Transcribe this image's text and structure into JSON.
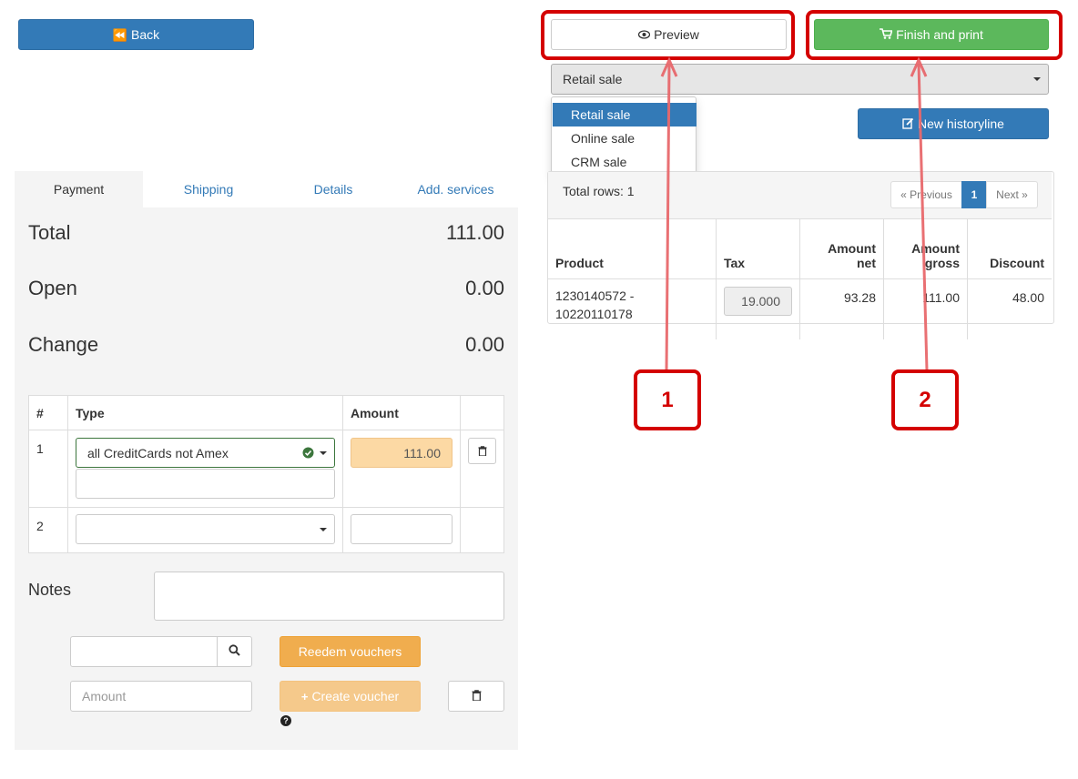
{
  "header": {
    "back_label": "Back",
    "preview_label": "Preview",
    "finish_label": "Finish and print"
  },
  "sale_type": {
    "selected": "Retail sale",
    "options": [
      "Retail sale",
      "Online sale",
      "CRM sale"
    ]
  },
  "new_historyline_label": "New historyline",
  "tabs": [
    "Payment",
    "Shipping",
    "Details",
    "Add. services"
  ],
  "summary": {
    "total_label": "Total",
    "total_value": "111.00",
    "open_label": "Open",
    "open_value": "0.00",
    "change_label": "Change",
    "change_value": "0.00"
  },
  "payment_table": {
    "headers": [
      "#",
      "Type",
      "Amount",
      ""
    ],
    "rows": [
      {
        "num": "1",
        "type": "all CreditCards not Amex",
        "amount": "111.00"
      },
      {
        "num": "2",
        "type": "",
        "amount": ""
      }
    ]
  },
  "notes_label": "Notes",
  "voucher": {
    "redeem_label": "Reedem vouchers",
    "amount_placeholder": "Amount",
    "create_label": "Create voucher"
  },
  "grid": {
    "total_rows_label": "Total rows: 1",
    "pager": {
      "prev": "« Previous",
      "page": "1",
      "next": "Next »"
    },
    "headers": [
      {
        "line1": "",
        "line2": "Product"
      },
      {
        "line1": "",
        "line2": "Tax"
      },
      {
        "line1": "Amount",
        "line2": "net"
      },
      {
        "line1": "Amount",
        "line2": "gross"
      },
      {
        "line1": "",
        "line2": "Discount"
      }
    ],
    "rows": [
      {
        "product_line1": "1230140572 -",
        "product_line2": "10220110178",
        "tax": "19.000",
        "amount_net": "93.28",
        "amount_gross": "111.00",
        "discount": "48.00"
      }
    ]
  },
  "annotations": {
    "callout_1": "1",
    "callout_2": "2"
  },
  "colors": {
    "primary": "#337ab7",
    "success": "#5cb85c",
    "warning": "#f0ad4e",
    "annotation": "#d40000"
  },
  "icons": [
    "backward-icon",
    "eye-icon",
    "cart-icon",
    "edit-icon",
    "check-circle-icon",
    "trash-icon",
    "search-icon",
    "plus-icon",
    "question-icon"
  ]
}
